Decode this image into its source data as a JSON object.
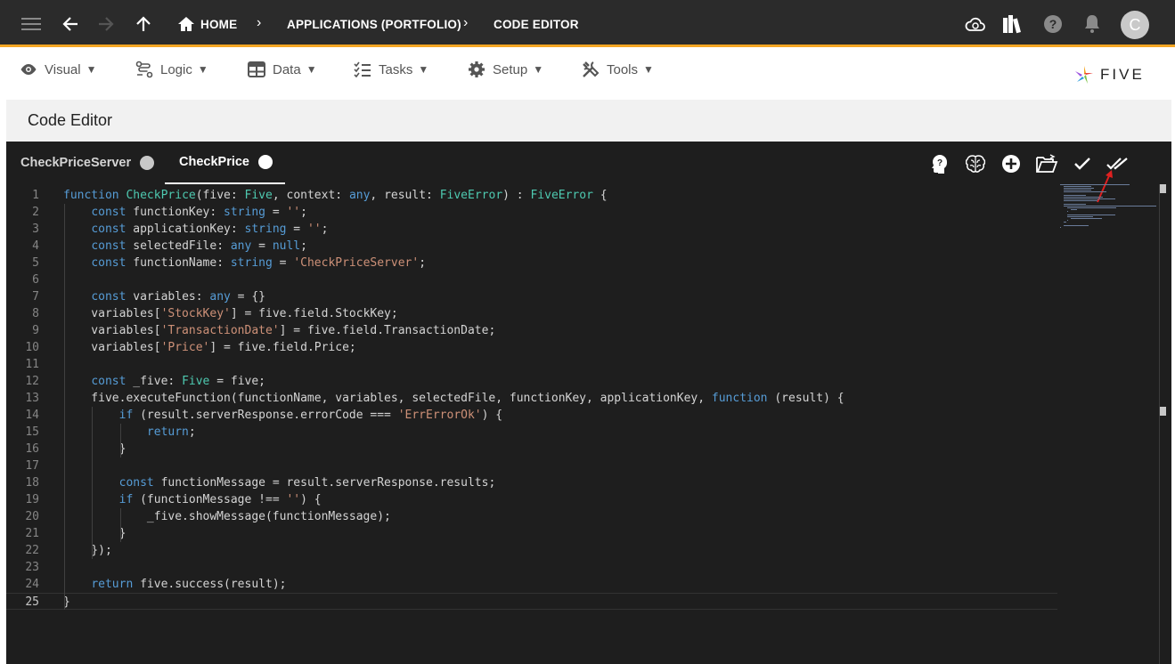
{
  "breadcrumb": {
    "home": "HOME",
    "applications": "APPLICATIONS (PORTFOLIO)",
    "current": "CODE EDITOR"
  },
  "user": {
    "avatar_letter": "C"
  },
  "menu": [
    {
      "label": "Visual",
      "icon": "eye-icon"
    },
    {
      "label": "Logic",
      "icon": "logic-icon"
    },
    {
      "label": "Data",
      "icon": "table-icon"
    },
    {
      "label": "Tasks",
      "icon": "checklist-icon"
    },
    {
      "label": "Setup",
      "icon": "gear-icon"
    },
    {
      "label": "Tools",
      "icon": "tools-icon"
    }
  ],
  "logo_text": "FIVE",
  "page_title": "Code Editor",
  "tabs": [
    {
      "label": "CheckPriceServer",
      "active": false
    },
    {
      "label": "CheckPrice",
      "active": true
    }
  ],
  "code": {
    "current_line": 25,
    "lines": [
      "function CheckPrice(five: Five, context: any, result: FiveError) : FiveError {",
      "    const functionKey: string = '';",
      "    const applicationKey: string = '';",
      "    const selectedFile: any = null;",
      "    const functionName: string = 'CheckPriceServer';",
      "",
      "    const variables: any = {}",
      "    variables['StockKey'] = five.field.StockKey;",
      "    variables['TransactionDate'] = five.field.TransactionDate;",
      "    variables['Price'] = five.field.Price;",
      "",
      "    const _five: Five = five;",
      "    five.executeFunction(functionName, variables, selectedFile, functionKey, applicationKey, function (result) {",
      "        if (result.serverResponse.errorCode === 'ErrErrorOk') {",
      "            return;",
      "        }",
      "",
      "        const functionMessage = result.serverResponse.results;",
      "        if (functionMessage !== '') {",
      "            _five.showMessage(functionMessage);",
      "        }",
      "    });",
      "",
      "    return five.success(result);",
      "}"
    ]
  }
}
